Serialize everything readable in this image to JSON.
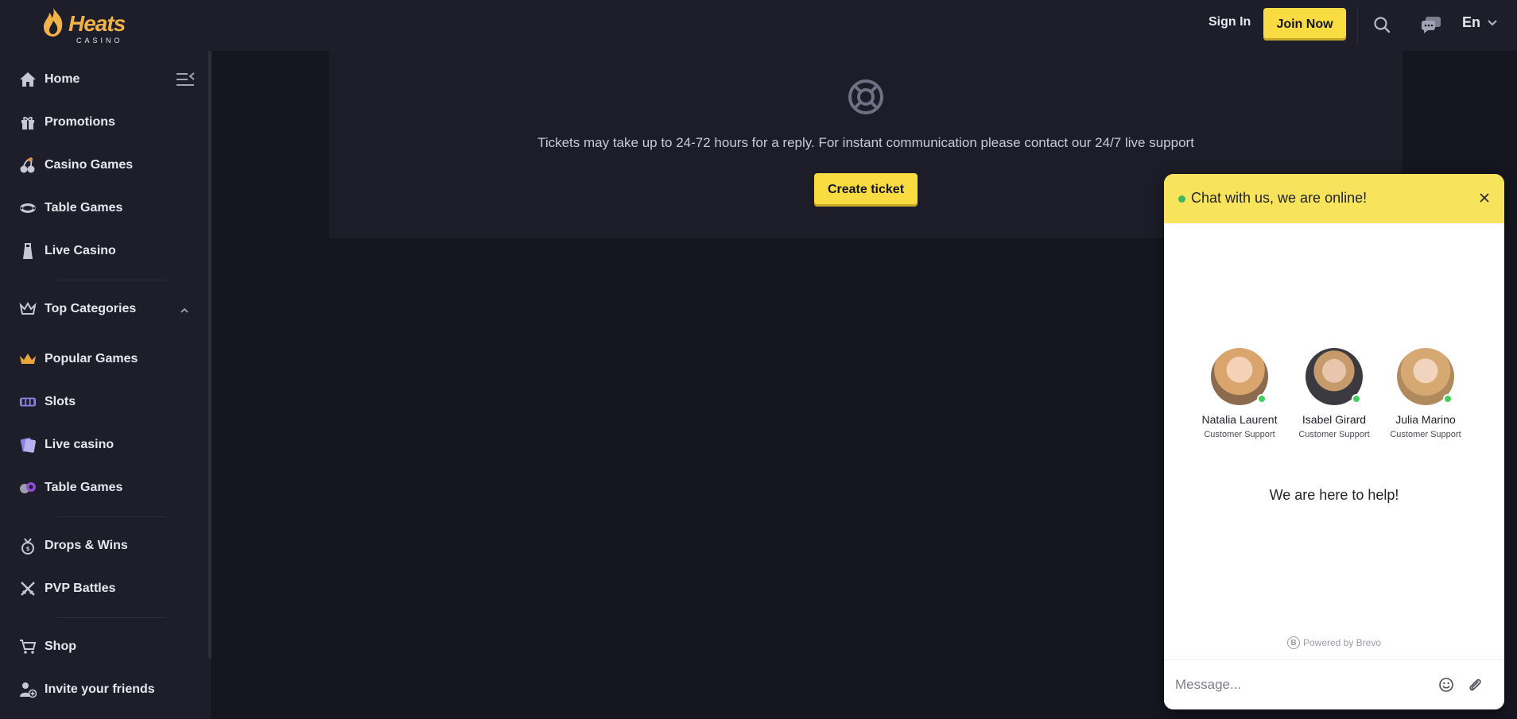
{
  "header": {
    "logo_text": "Heats",
    "logo_sub": "CASINO",
    "signin_label": "Sign In",
    "join_label": "Join Now",
    "language": "En"
  },
  "sidebar": {
    "items": [
      {
        "label": "Home",
        "icon": "home-icon"
      },
      {
        "label": "Promotions",
        "icon": "gift-icon"
      },
      {
        "label": "Casino Games",
        "icon": "cherries-icon"
      },
      {
        "label": "Table Games",
        "icon": "table-icon"
      },
      {
        "label": "Live Casino",
        "icon": "live-dealer-icon"
      }
    ],
    "top_categories_label": "Top Categories",
    "categories": [
      {
        "label": "Popular Games",
        "icon": "crown-icon"
      },
      {
        "label": "Slots",
        "icon": "slots-icon"
      },
      {
        "label": "Live casino",
        "icon": "cards-icon"
      },
      {
        "label": "Table Games",
        "icon": "chips-icon"
      }
    ],
    "extra": [
      {
        "label": "Drops & Wins",
        "icon": "drops-icon"
      },
      {
        "label": "PVP Battles",
        "icon": "swords-icon"
      }
    ],
    "bottom": [
      {
        "label": "Shop",
        "icon": "cart-icon"
      },
      {
        "label": "Invite your friends",
        "icon": "invite-icon"
      }
    ]
  },
  "main": {
    "ticket_text": "Tickets may take up to 24-72 hours for a reply. For instant communication please contact our 24/7 live support",
    "create_ticket_label": "Create ticket"
  },
  "chat": {
    "title": "Chat with us, we are online!",
    "agents": [
      {
        "name": "Natalia Laurent",
        "role": "Customer Support"
      },
      {
        "name": "Isabel Girard",
        "role": "Customer Support"
      },
      {
        "name": "Julia Marino",
        "role": "Customer Support"
      }
    ],
    "help_text": "We are here to help!",
    "powered_by": "Powered by Brevo",
    "input_placeholder": "Message..."
  },
  "colors": {
    "accent": "#f8dc42",
    "chat_header": "#f8e45c",
    "online": "#3fcf5a",
    "background": "#15161f",
    "panel": "#1d1e29"
  }
}
